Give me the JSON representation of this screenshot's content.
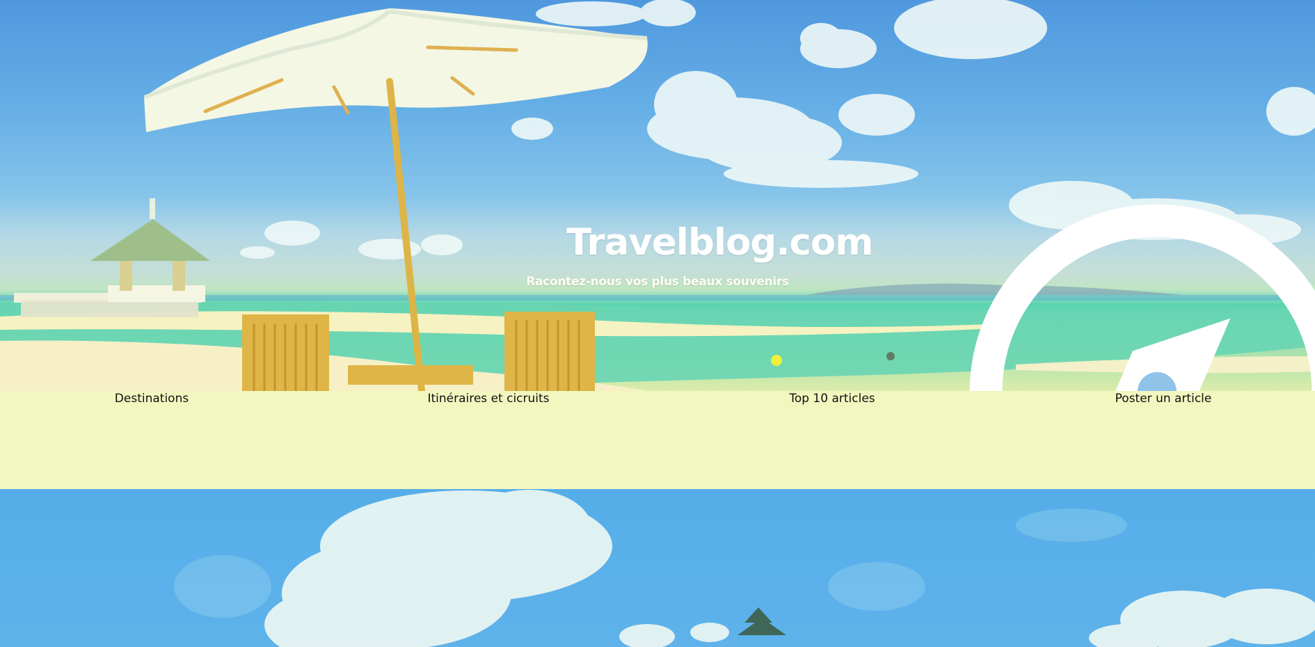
{
  "header": {
    "brand_name": "Travelblog.com",
    "tagline": "Racontez-nous vos plus beaux souvenirs",
    "logo_icon": "compass-icon"
  },
  "nav": {
    "items": [
      {
        "label": "Destinations"
      },
      {
        "label": "Itinéraires et cicruits"
      },
      {
        "label": "Top 10 articles"
      },
      {
        "label": "Poster un article"
      }
    ]
  },
  "colors": {
    "nav_background": "#f2f7bf",
    "title_text": "#ffffff",
    "nav_text": "#111111"
  }
}
